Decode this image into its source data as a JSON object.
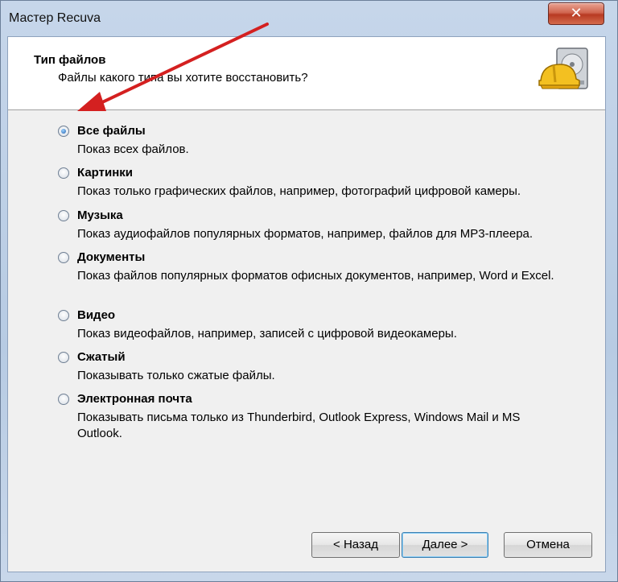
{
  "window": {
    "title": "Мастер Recuva",
    "close_symbol": "✕"
  },
  "header": {
    "title": "Тип файлов",
    "subtitle": "Файлы какого типа вы хотите восстановить?",
    "icon": "hard-drive-helmet-icon"
  },
  "options": [
    {
      "label": "Все файлы",
      "desc": "Показ всех файлов.",
      "selected": true
    },
    {
      "label": "Картинки",
      "desc": "Показ только графических файлов, например, фотографий цифровой камеры.",
      "selected": false
    },
    {
      "label": "Музыка",
      "desc": "Показ аудиофайлов популярных форматов, например, файлов для MP3-плеера.",
      "selected": false
    },
    {
      "label": "Документы",
      "desc": "Показ файлов популярных форматов офисных документов, например, Word и Excel.",
      "selected": false
    },
    {
      "label": "Видео",
      "desc": "Показ видеофайлов, например, записей с цифровой видеокамеры.",
      "selected": false
    },
    {
      "label": "Сжатый",
      "desc": "Показывать только сжатые файлы.",
      "selected": false
    },
    {
      "label": "Электронная почта",
      "desc": "Показывать письма только из Thunderbird, Outlook Express, Windows Mail и MS Outlook.",
      "selected": false
    }
  ],
  "buttons": {
    "back": "< Назад",
    "next": "Далее >",
    "cancel": "Отмена"
  },
  "annotation": {
    "arrow_color": "#d42020"
  }
}
